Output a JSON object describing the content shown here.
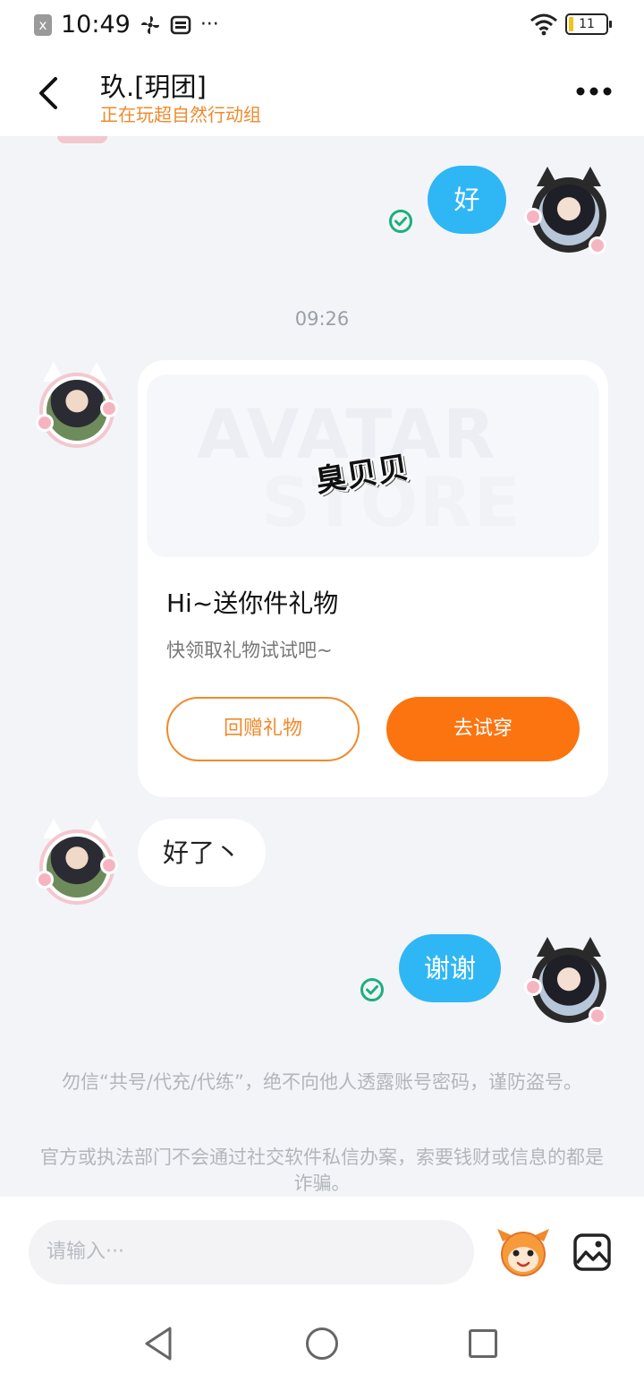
{
  "status_bar": {
    "time": "10:49",
    "notif_box": "x",
    "icons": [
      "fan-icon",
      "sim-icon",
      "more-dots-icon",
      "wifi-icon",
      "battery-icon"
    ],
    "more": "···",
    "battery_level": "11"
  },
  "header": {
    "title": "玖.[玥团]",
    "subtitle": "正在玩超自然行动组"
  },
  "chat": {
    "messages": [
      {
        "direction": "out",
        "text": "好",
        "status": "read"
      },
      {
        "type": "timestamp",
        "text": "09:26"
      },
      {
        "direction": "in",
        "type": "gift_card",
        "banner_logo": "臭贝贝",
        "banner_watermark_1": "AVATAR",
        "banner_watermark_2": "STORE",
        "title": "Hi~送你件礼物",
        "desc": "快领取礼物试试吧~",
        "btn_return": "回赠礼物",
        "btn_try": "去试穿"
      },
      {
        "direction": "in",
        "text": "好了丶"
      },
      {
        "direction": "out",
        "text": "谢谢",
        "status": "read"
      }
    ],
    "notice_1": "勿信“共号/代充/代练”，绝不向他人透露账号密码，谨防盗号。",
    "notice_2": "官方或执法部门不会通过社交软件私信办案，索要钱财或信息的都是诈骗。"
  },
  "input": {
    "placeholder": "请输入···"
  },
  "colors": {
    "accent": "#fb7410",
    "accent_text": "#f08a2c",
    "outgoing_bubble": "#2fb6f5",
    "read_check": "#1bb07a",
    "background": "#f3f4f8"
  }
}
